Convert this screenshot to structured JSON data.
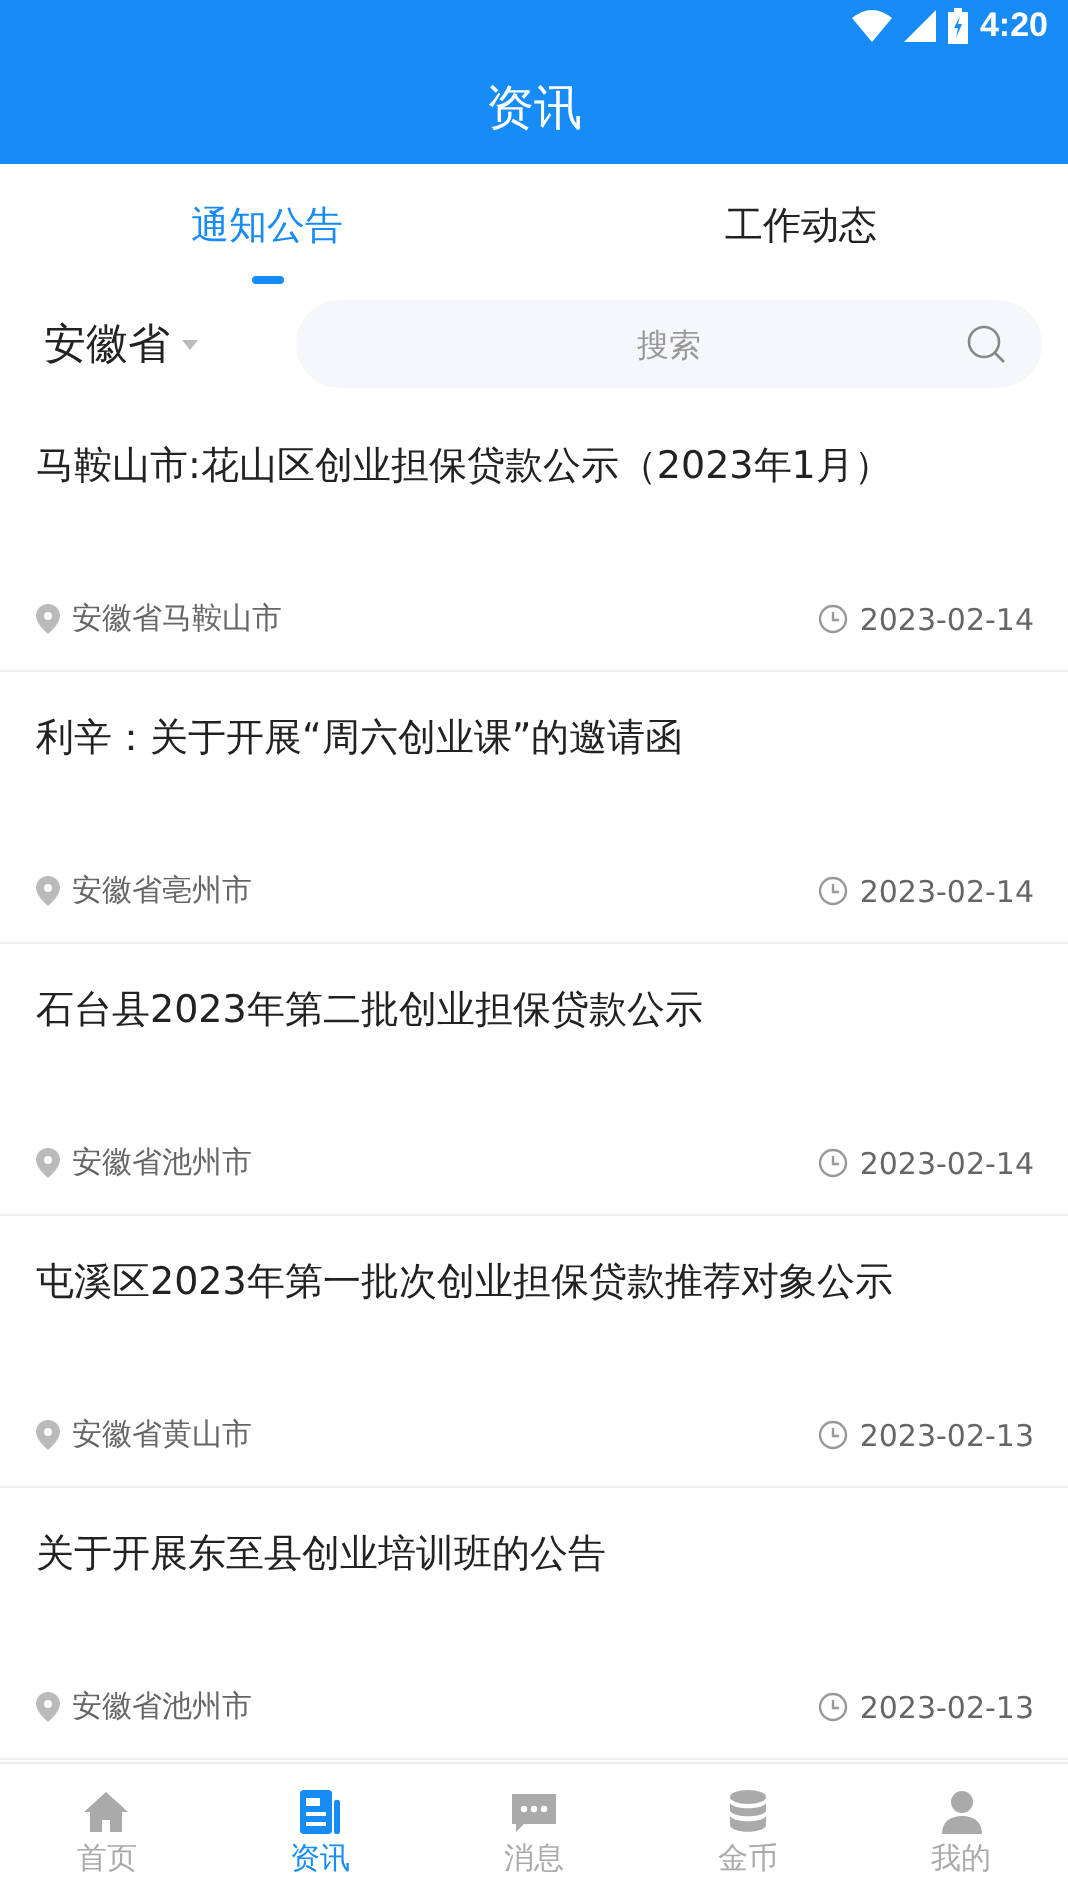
{
  "status_bar": {
    "time": "4:20"
  },
  "header": {
    "title": "资讯"
  },
  "tabs": [
    {
      "label": "通知公告",
      "selected": true
    },
    {
      "label": "工作动态",
      "selected": false
    }
  ],
  "filter": {
    "province": "安徽省",
    "search": {
      "placeholder": "搜索"
    }
  },
  "articles": [
    {
      "title": "马鞍山市:花山区创业担保贷款公示（2023年1月）",
      "location": "安徽省马鞍山市",
      "date": "2023-02-14"
    },
    {
      "title": "利辛：关于开展“周六创业课”的邀请函",
      "location": "安徽省亳州市",
      "date": "2023-02-14"
    },
    {
      "title": "石台县2023年第二批创业担保贷款公示",
      "location": "安徽省池州市",
      "date": "2023-02-14"
    },
    {
      "title": "屯溪区2023年第一批次创业担保贷款推荐对象公示",
      "location": "安徽省黄山市",
      "date": "2023-02-13"
    },
    {
      "title": "关于开展东至县创业培训班的公告",
      "location": "安徽省池州市",
      "date": "2023-02-13"
    }
  ],
  "bottom_nav": [
    {
      "kind": "home",
      "label": "首页",
      "selected": false
    },
    {
      "kind": "news",
      "label": "资讯",
      "selected": true
    },
    {
      "kind": "message",
      "label": "消息",
      "selected": false
    },
    {
      "kind": "coins",
      "label": "金币",
      "selected": false
    },
    {
      "kind": "profile",
      "label": "我的",
      "selected": false
    }
  ]
}
